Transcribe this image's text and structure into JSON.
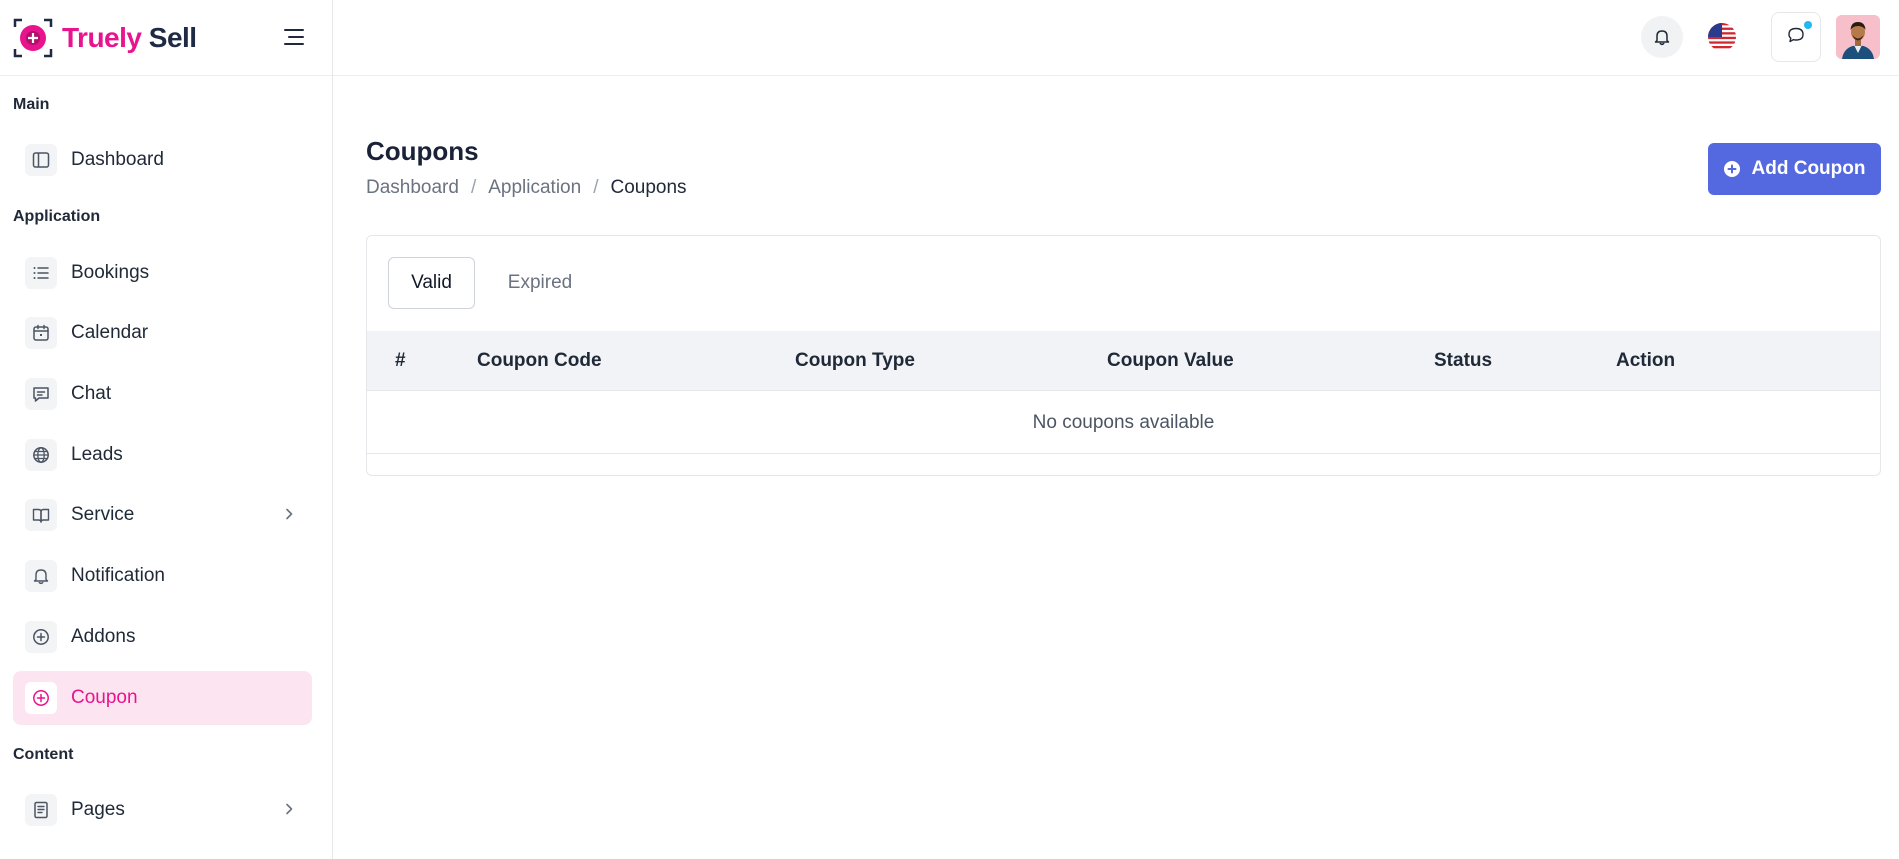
{
  "brand": {
    "name_part1": "Truely",
    "name_part2": " Sell"
  },
  "sidebar": {
    "sections": [
      "Main",
      "Application",
      "Content"
    ],
    "items": [
      {
        "label": "Dashboard",
        "icon": "sidebar-panel-icon"
      },
      {
        "label": "Bookings",
        "icon": "list-icon"
      },
      {
        "label": "Calendar",
        "icon": "calendar-icon"
      },
      {
        "label": "Chat",
        "icon": "message-icon"
      },
      {
        "label": "Leads",
        "icon": "globe-icon"
      },
      {
        "label": "Service",
        "icon": "book-icon"
      },
      {
        "label": "Notification",
        "icon": "bell-icon"
      },
      {
        "label": "Addons",
        "icon": "plus-circle-icon"
      },
      {
        "label": "Coupon",
        "icon": "plus-circle-icon"
      },
      {
        "label": "Pages",
        "icon": "document-icon"
      }
    ]
  },
  "header": {
    "icons": [
      "bell-icon",
      "us-flag-icon",
      "chat-icon",
      "avatar"
    ]
  },
  "page": {
    "title": "Coupons",
    "breadcrumb": [
      "Dashboard",
      "Application",
      "Coupons"
    ],
    "add_button": "Add Coupon"
  },
  "tabs": [
    {
      "label": "Valid"
    },
    {
      "label": "Expired"
    }
  ],
  "table": {
    "columns": [
      "#",
      "Coupon Code",
      "Coupon Type",
      "Coupon Value",
      "Status",
      "Action"
    ],
    "empty_message": "No coupons available"
  },
  "colors": {
    "accent_pink": "#e8148e",
    "primary_blue": "#5468e0",
    "active_bg": "#fde4f1"
  }
}
